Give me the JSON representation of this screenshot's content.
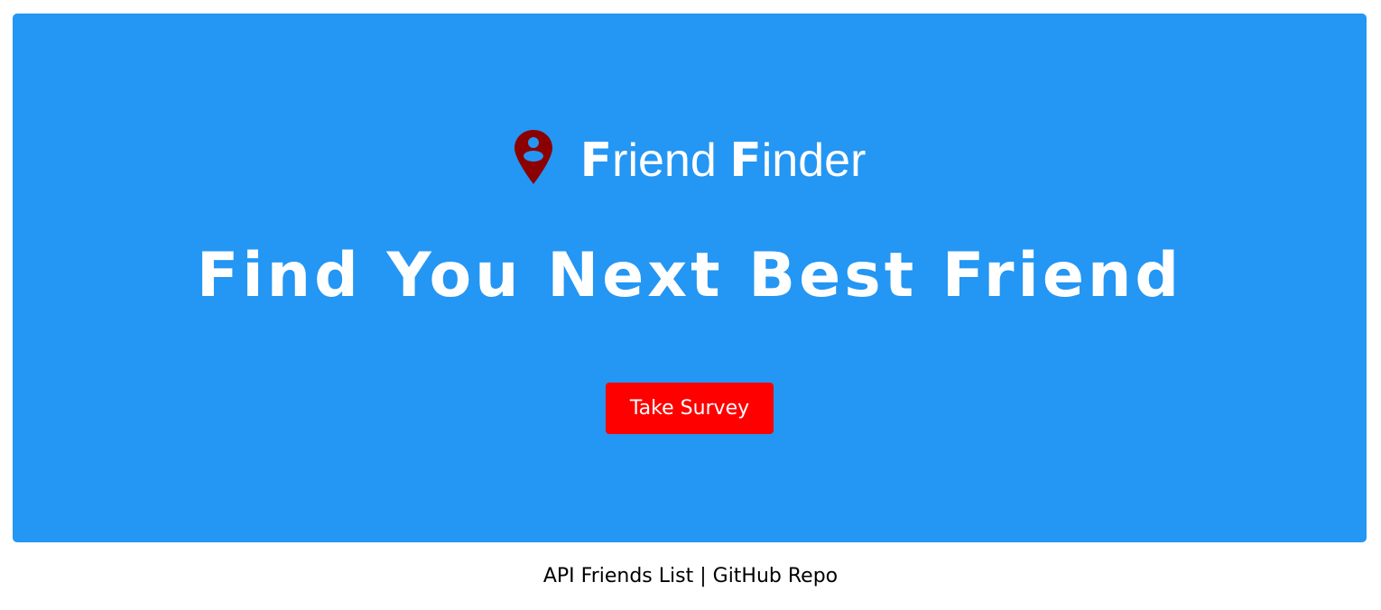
{
  "brand": {
    "first_initial": "F",
    "first_rest": "riend ",
    "second_initial": "F",
    "second_rest": "inder",
    "icon": "map-pin-person-icon",
    "icon_color": "#8b0000"
  },
  "hero": {
    "headline": "Find You Next Best Friend",
    "button_label": "Take Survey",
    "background": "#2496f3",
    "button_color": "#ff0000"
  },
  "footer": {
    "link1": "API Friends List",
    "separator": " | ",
    "link2": "GitHub Repo"
  }
}
